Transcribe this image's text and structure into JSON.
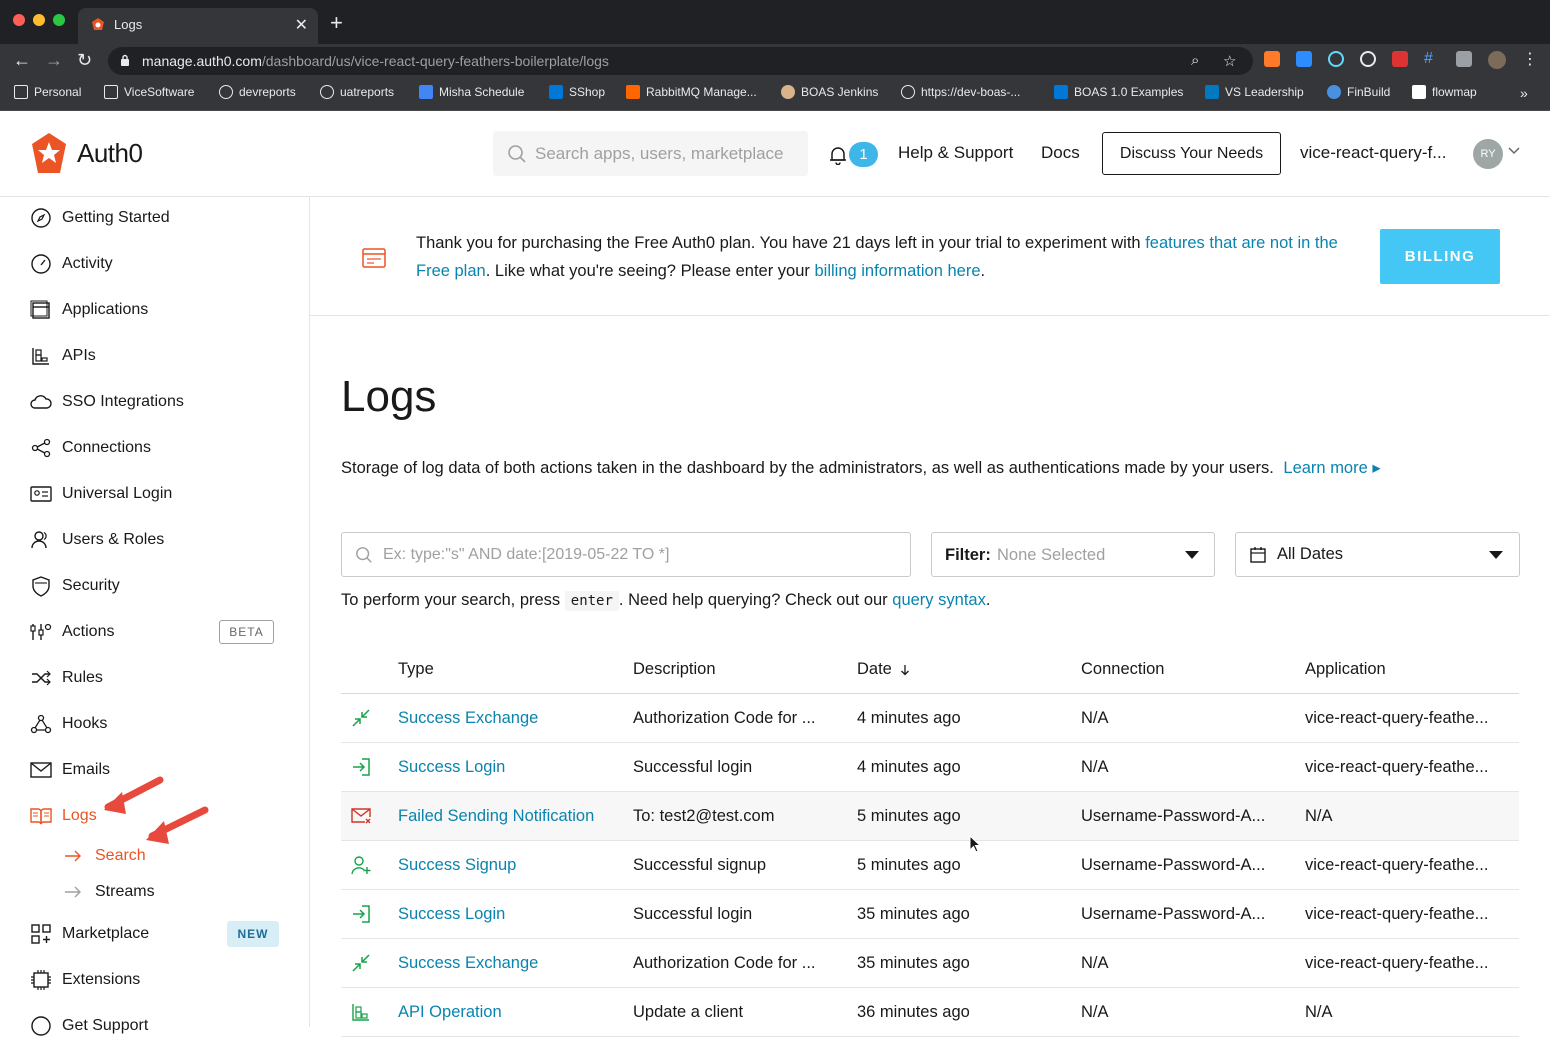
{
  "browser": {
    "tab_title": "Logs",
    "url_host": "manage.auth0.com",
    "url_path": "/dashboard/us/vice-react-query-feathers-boilerplate/logs",
    "bookmarks": [
      "Personal",
      "ViceSoftware",
      "devreports",
      "uatreports",
      "Misha Schedule",
      "SShop",
      "RabbitMQ Manage...",
      "BOAS Jenkins",
      "https://dev-boas-...",
      "BOAS 1.0 Examples",
      "VS Leadership",
      "FinBuild",
      "flowmap"
    ]
  },
  "header": {
    "logo_text": "Auth0",
    "search_placeholder": "Search apps, users, marketplace",
    "notification_count": "1",
    "help_label": "Help & Support",
    "docs_label": "Docs",
    "discuss_label": "Discuss Your Needs",
    "tenant_label": "vice-react-query-f...",
    "avatar_initials": "RY"
  },
  "sidebar": {
    "items": [
      {
        "label": "Getting Started"
      },
      {
        "label": "Activity"
      },
      {
        "label": "Applications"
      },
      {
        "label": "APIs"
      },
      {
        "label": "SSO Integrations"
      },
      {
        "label": "Connections"
      },
      {
        "label": "Universal Login"
      },
      {
        "label": "Users & Roles"
      },
      {
        "label": "Security"
      },
      {
        "label": "Actions",
        "tag": "BETA"
      },
      {
        "label": "Rules"
      },
      {
        "label": "Hooks"
      },
      {
        "label": "Emails"
      },
      {
        "label": "Logs"
      },
      {
        "label": "Marketplace",
        "tag": "NEW"
      },
      {
        "label": "Extensions"
      },
      {
        "label": "Get Support"
      }
    ],
    "sub_items": [
      {
        "label": "Search"
      },
      {
        "label": "Streams"
      }
    ]
  },
  "banner": {
    "text_1": "Thank you for purchasing the Free Auth0 plan. You have 21 days left in your trial to experiment with ",
    "link_1": "features that are not in the Free plan",
    "text_2": ". Like what you're seeing? Please enter your ",
    "link_2": "billing information here",
    "text_3": ".",
    "billing_button": "BILLING"
  },
  "main": {
    "title": "Logs",
    "description": "Storage of log data of both actions taken in the dashboard by the administrators, as well as authentications made by your users.",
    "learn_more": "Learn more ▸",
    "query_placeholder": "Ex: type:\"s\" AND date:[2019-05-22 TO *]",
    "filter_label": "Filter:",
    "filter_value": "None Selected",
    "dates_value": "All Dates",
    "hint_1": "To perform your search, press",
    "hint_code": "enter",
    "hint_2": ". Need help querying? Check out our",
    "hint_link": "query syntax",
    "hint_3": "."
  },
  "table": {
    "columns": [
      "Type",
      "Description",
      "Date",
      "Connection",
      "Application"
    ],
    "rows": [
      {
        "icon": "exchange-icon",
        "type": "Success Exchange",
        "description": "Authorization Code for ...",
        "date": "4 minutes ago",
        "connection": "N/A",
        "application": "vice-react-query-feathe..."
      },
      {
        "icon": "login-icon",
        "type": "Success Login",
        "description": "Successful login",
        "date": "4 minutes ago",
        "connection": "N/A",
        "application": "vice-react-query-feathe..."
      },
      {
        "icon": "failed-mail-icon",
        "type": "Failed Sending Notification",
        "description": "To: test2@test.com",
        "date": "5 minutes ago",
        "connection": "Username-Password-A...",
        "application": "N/A"
      },
      {
        "icon": "signup-icon",
        "type": "Success Signup",
        "description": "Successful signup",
        "date": "5 minutes ago",
        "connection": "Username-Password-A...",
        "application": "vice-react-query-feathe..."
      },
      {
        "icon": "login-icon",
        "type": "Success Login",
        "description": "Successful login",
        "date": "35 minutes ago",
        "connection": "Username-Password-A...",
        "application": "vice-react-query-feathe..."
      },
      {
        "icon": "exchange-icon",
        "type": "Success Exchange",
        "description": "Authorization Code for ...",
        "date": "35 minutes ago",
        "connection": "N/A",
        "application": "vice-react-query-feathe..."
      },
      {
        "icon": "api-icon",
        "type": "API Operation",
        "description": "Update a client",
        "date": "36 minutes ago",
        "connection": "N/A",
        "application": "N/A"
      }
    ]
  },
  "colors": {
    "accent": "#eb5424",
    "link": "#0a84ae",
    "billing": "#44c7f4",
    "success": "#16a34a",
    "failed": "#d0342c"
  }
}
